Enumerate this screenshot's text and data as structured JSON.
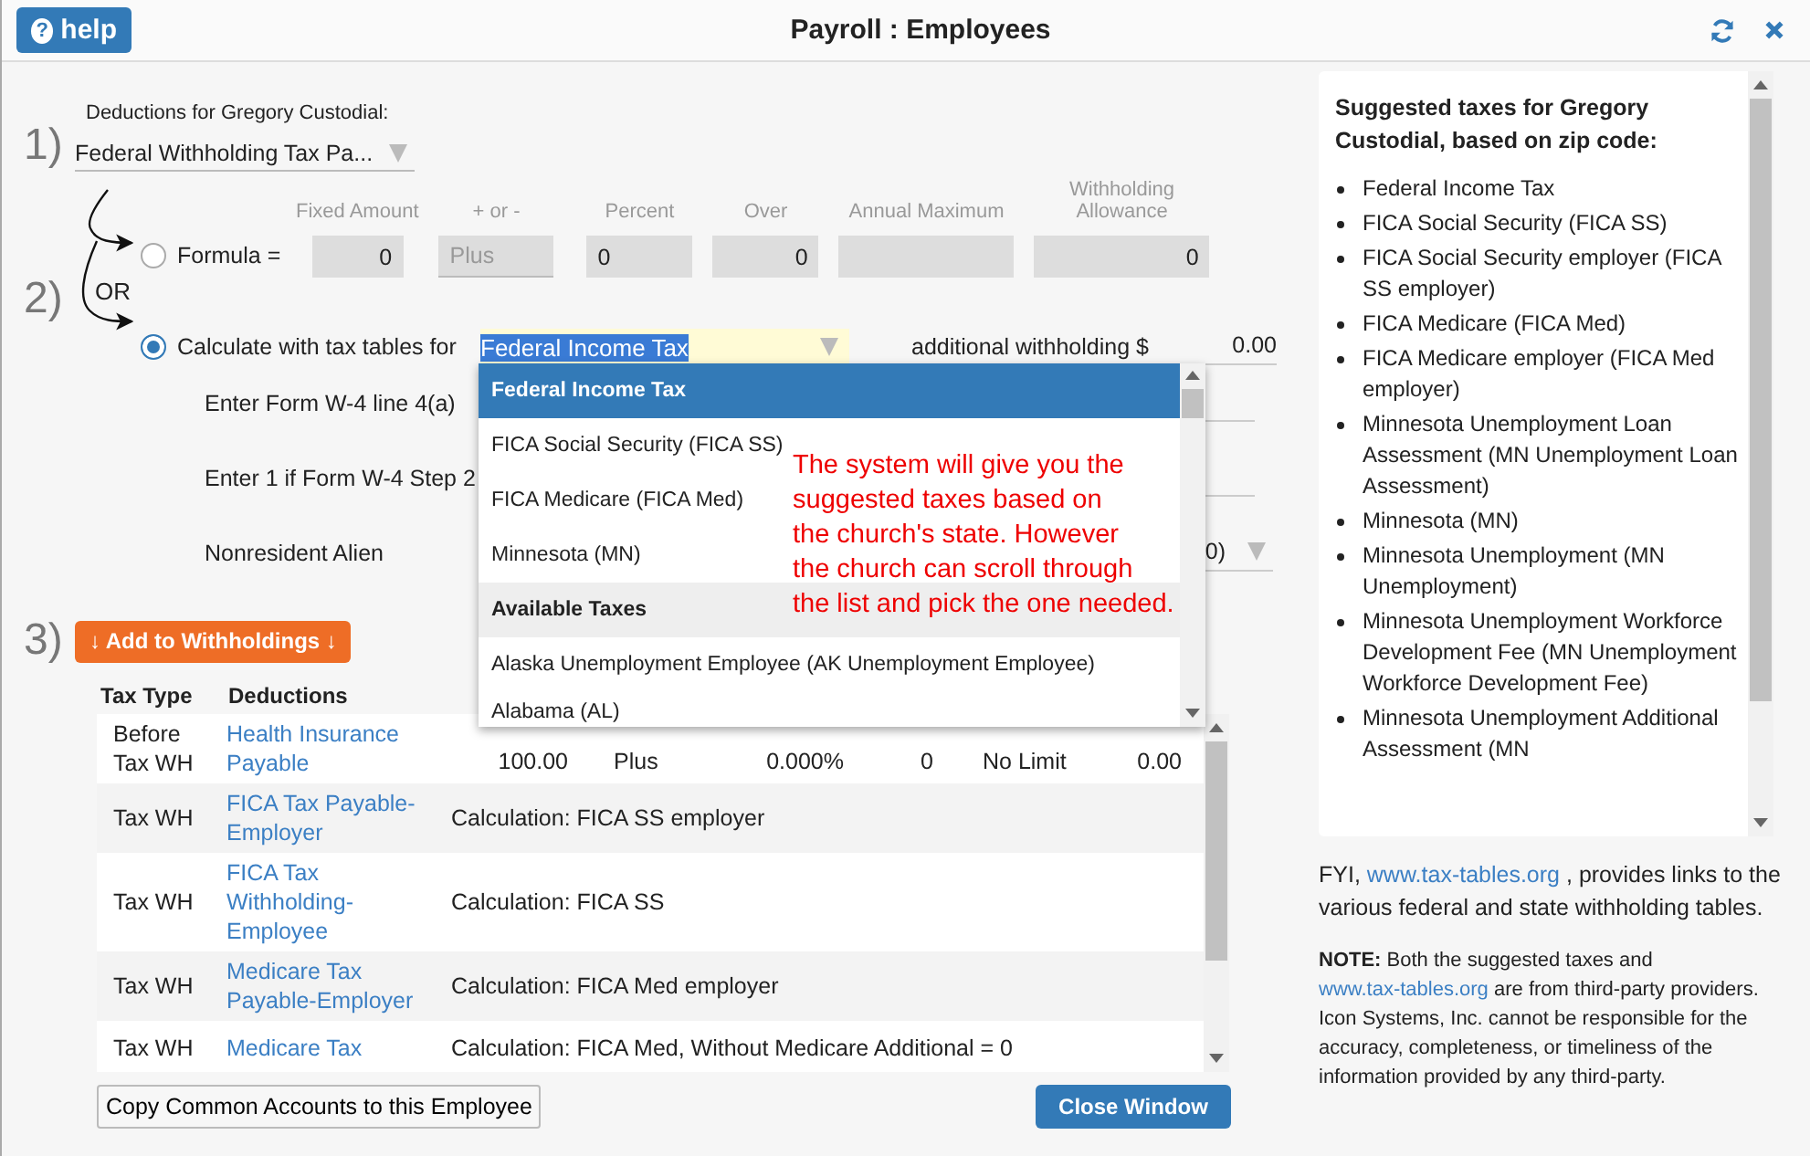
{
  "header": {
    "help_icon": "?",
    "help_label": "help",
    "title": "Payroll : Employees"
  },
  "deductions": {
    "number": "1)",
    "label": "Deductions for Gregory Custodial:",
    "value": "Federal Withholding Tax Pa..."
  },
  "method": {
    "number": "2)",
    "or_label": "OR",
    "formula": {
      "label": "Formula =",
      "selected": false,
      "columns": [
        {
          "label": "Fixed Amount",
          "value": "0"
        },
        {
          "label": "+ or -",
          "placeholder": "Plus"
        },
        {
          "label": "Percent",
          "value": "0"
        },
        {
          "label": "Over",
          "value": "0"
        },
        {
          "label": "Annual Maximum"
        },
        {
          "label": "Withholding Allowance",
          "value": "0"
        }
      ]
    },
    "tax_tables": {
      "label": "Calculate with tax tables for",
      "selected": true,
      "tax": "Federal Income Tax",
      "additional_label": "additional withholding $",
      "additional_value": "0.00"
    },
    "w4_rows": [
      {
        "kind": "field",
        "label": "Enter Form W-4 line 4(a)"
      },
      {
        "kind": "field",
        "label": "Enter 1 if Form W-4 Step 2"
      },
      {
        "kind": "select",
        "label": "Nonresident Alien",
        "value": "0)"
      }
    ]
  },
  "dropdown": {
    "items": [
      {
        "kind": "option",
        "label": "Federal Income Tax",
        "selected": true
      },
      {
        "kind": "option",
        "label": "FICA Social Security (FICA SS)",
        "selected": false
      },
      {
        "kind": "option",
        "label": "FICA Medicare (FICA Med)",
        "selected": false
      },
      {
        "kind": "option",
        "label": "Minnesota (MN)",
        "selected": false
      },
      {
        "kind": "group",
        "label": "Available Taxes",
        "selected": false
      },
      {
        "kind": "option",
        "label": "Alaska Unemployment Employee (AK Unemployment Employee)",
        "selected": false
      },
      {
        "kind": "option",
        "label": "Alabama (AL)",
        "selected": false
      }
    ]
  },
  "annotation": "The system will give you the\nsuggested taxes based on\nthe church's state. However\nthe church can scroll through\nthe list and pick the one needed.",
  "withholdings": {
    "number": "3)",
    "add_button": "↓ Add to Withholdings ↓",
    "columns": [
      "Tax Type",
      "Deductions"
    ],
    "rows": [
      {
        "kind": "values",
        "tax_type": "Before Tax WH",
        "deduction": "Health Insurance Payable",
        "values": [
          "100.00",
          "Plus",
          "0.000%",
          "0",
          "No Limit",
          "0.00"
        ]
      },
      {
        "kind": "calculation",
        "tax_type": "Tax WH",
        "deduction": "FICA Tax Payable-Employer",
        "calculation": "Calculation: FICA SS employer"
      },
      {
        "kind": "calculation",
        "tax_type": "Tax WH",
        "deduction": "FICA Tax Withholding-Employee",
        "calculation": "Calculation: FICA SS"
      },
      {
        "kind": "calculation",
        "tax_type": "Tax WH",
        "deduction": "Medicare Tax Payable-Employer",
        "calculation": "Calculation: FICA Med employer"
      },
      {
        "kind": "calculation",
        "tax_type": "Tax WH",
        "deduction": "Medicare Tax",
        "calculation": "Calculation: FICA Med, Without Medicare Additional = 0"
      }
    ]
  },
  "copy_button": "Copy Common Accounts to this Employee",
  "close_button": "Close Window",
  "suggested": {
    "title": "Suggested taxes for Gregory Custodial, based on zip code:",
    "items": [
      "Federal Income Tax",
      "FICA Social Security (FICA SS)",
      "FICA Social Security employer (FICA SS employer)",
      "FICA Medicare (FICA Med)",
      "FICA Medicare employer (FICA Med employer)",
      "Minnesota Unemployment Loan Assessment (MN Unemployment Loan Assessment)",
      "Minnesota (MN)",
      "Minnesota Unemployment (MN Unemployment)",
      "Minnesota Unemployment Workforce Development Fee (MN Unemployment Workforce Development Fee)",
      "Minnesota Unemployment Additional Assessment (MN"
    ]
  },
  "fyi": {
    "before": "FYI,",
    "link": "www.tax-tables.org",
    "after": ", provides links to the various federal and state withholding tables."
  },
  "note": {
    "before": "**NOTE:** Both the suggested taxes and",
    "link": "www.tax-tables.org",
    "after": "are from third-party providers. Icon Systems, Inc. cannot be responsible for the accuracy, completeness, or timeliness of the information provided by any third-party."
  }
}
